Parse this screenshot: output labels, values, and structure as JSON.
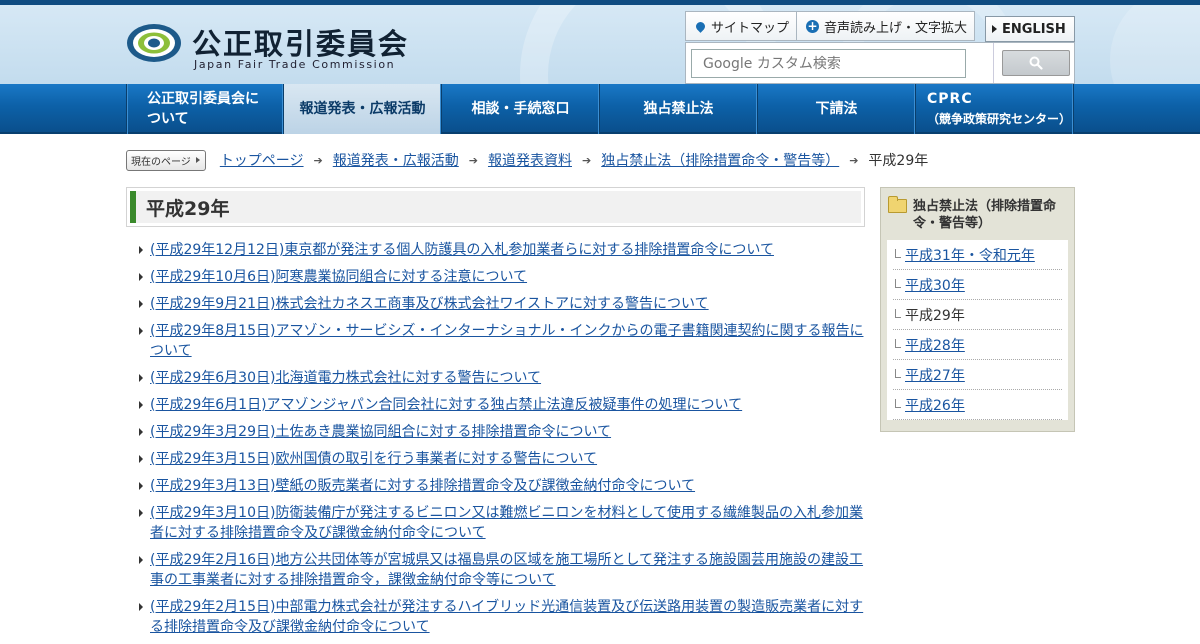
{
  "header": {
    "title": "公正取引委員会",
    "subtitle": "Japan Fair Trade Commission",
    "util": {
      "sitemap": "サイトマップ",
      "voice": "音声読み上げ・文字拡大",
      "english": "ENGLISH"
    },
    "search": {
      "placeholder": "Google カスタム検索"
    }
  },
  "nav": {
    "items": [
      {
        "label": "公正取引委員会について"
      },
      {
        "label": "報道発表・広報活動"
      },
      {
        "label": "相談・手続窓口"
      },
      {
        "label": "独占禁止法"
      },
      {
        "label": "下請法"
      }
    ],
    "cprc_main": "CPRC",
    "cprc_sub": "（競争政策研究センター）"
  },
  "breadcrumb": {
    "badge": "現在のページ",
    "links": [
      "トップページ",
      "報道発表・広報活動",
      "報道発表資料",
      "独占禁止法（排除措置命令・警告等）"
    ],
    "current": "平成29年"
  },
  "main": {
    "heading": "平成29年",
    "items": [
      "(平成29年12月12日)東京都が発注する個人防護具の入札参加業者らに対する排除措置命令について",
      "(平成29年10月6日)阿寒農業協同組合に対する注意について",
      "(平成29年9月21日)株式会社カネスエ商事及び株式会社ワイストアに対する警告について",
      "(平成29年8月15日)アマゾン・サービシズ・インターナショナル・インクからの電子書籍関連契約に関する報告について",
      "(平成29年6月30日)北海道電力株式会社に対する警告について",
      "(平成29年6月1日)アマゾンジャパン合同会社に対する独占禁止法違反被疑事件の処理について",
      "(平成29年3月29日)土佐あき農業協同組合に対する排除措置命令について",
      "(平成29年3月15日)欧州国債の取引を行う事業者に対する警告について",
      "(平成29年3月13日)壁紙の販売業者に対する排除措置命令及び課徴金納付命令について",
      "(平成29年3月10日)防衛装備庁が発注するビニロン又は難燃ビニロンを材料として使用する繊維製品の入札参加業者に対する排除措置命令及び課徴金納付命令について",
      "(平成29年2月16日)地方公共団体等が宮城県又は福島県の区域を施工場所として発注する施設園芸用施設の建設工事の工事業者に対する排除措置命令，課徴金納付命令等について",
      "(平成29年2月15日)中部電力株式会社が発注するハイブリッド光通信装置及び伝送路用装置の製造販売業者に対する排除措置命令及び課徴金納付命令について"
    ]
  },
  "side": {
    "title": "独占禁止法（排除措置命令・警告等）",
    "items": [
      "平成31年・令和元年",
      "平成30年",
      "平成29年",
      "平成28年",
      "平成27年",
      "平成26年"
    ]
  }
}
